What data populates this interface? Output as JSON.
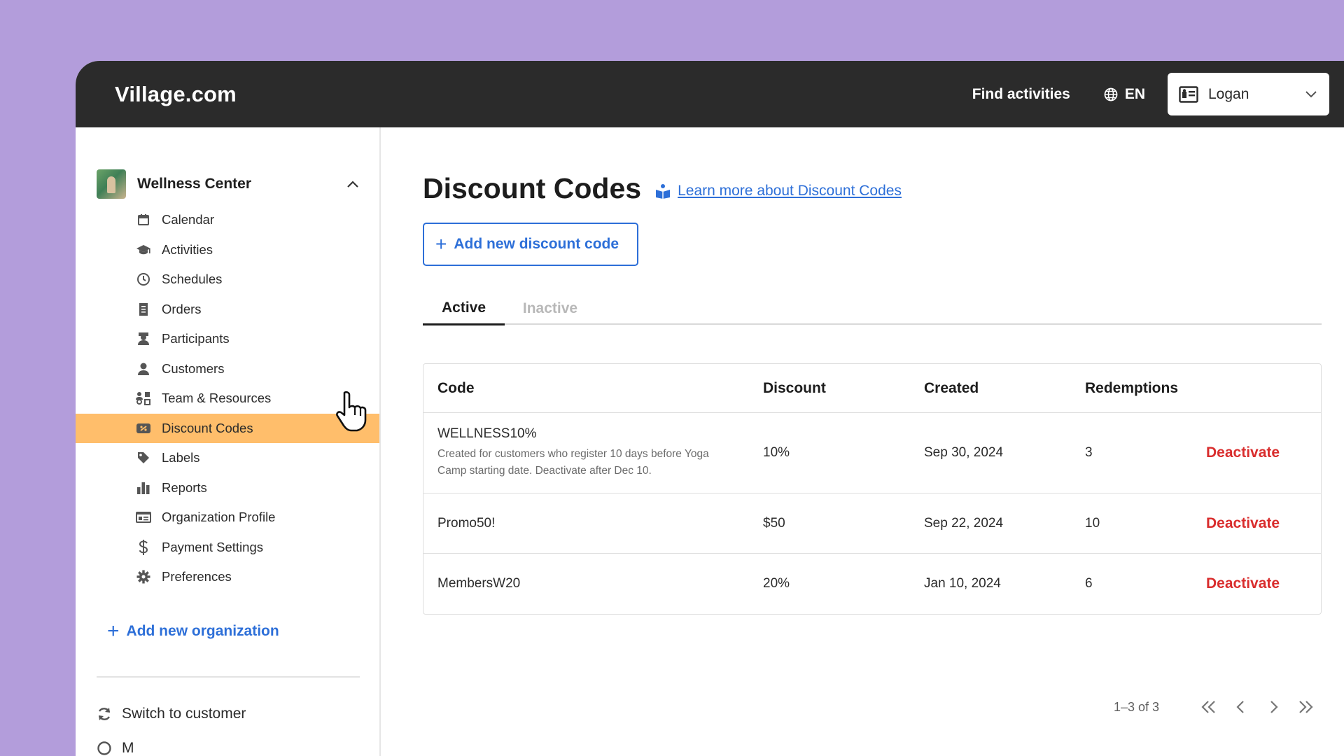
{
  "header": {
    "brand": "Village.com",
    "find_activities": "Find activities",
    "language": "EN",
    "user_name": "Logan"
  },
  "sidebar": {
    "org_name": "Wellness Center",
    "items": [
      {
        "label": "Calendar",
        "icon": "calendar-icon"
      },
      {
        "label": "Activities",
        "icon": "graduation-cap-icon"
      },
      {
        "label": "Schedules",
        "icon": "clock-icon"
      },
      {
        "label": "Orders",
        "icon": "receipt-icon"
      },
      {
        "label": "Participants",
        "icon": "participant-icon"
      },
      {
        "label": "Customers",
        "icon": "person-icon"
      },
      {
        "label": "Team & Resources",
        "icon": "team-icon"
      },
      {
        "label": "Discount Codes",
        "icon": "discount-tag-icon",
        "active": true
      },
      {
        "label": "Labels",
        "icon": "label-icon"
      },
      {
        "label": "Reports",
        "icon": "bar-chart-icon"
      },
      {
        "label": "Organization Profile",
        "icon": "id-card-icon"
      },
      {
        "label": "Payment Settings",
        "icon": "dollar-icon"
      },
      {
        "label": "Preferences",
        "icon": "gear-icon"
      }
    ],
    "add_org": "Add new organization",
    "switch_customer": "Switch to customer",
    "more_label": "M"
  },
  "main": {
    "title": "Discount Codes",
    "learn_more": "Learn more about Discount Codes",
    "add_button": "Add new discount code",
    "tabs": {
      "active": "Active",
      "inactive": "Inactive"
    },
    "table": {
      "headers": {
        "code": "Code",
        "discount": "Discount",
        "created": "Created",
        "redemptions": "Redemptions"
      },
      "rows": [
        {
          "code": "WELLNESS10%",
          "description": "Created for customers who register 10 days before Yoga Camp starting date. Deactivate after Dec 10.",
          "discount": "10%",
          "created": "Sep 30, 2024",
          "redemptions": "3",
          "action": "Deactivate"
        },
        {
          "code": "Promo50!",
          "description": "",
          "discount": "$50",
          "created": "Sep 22, 2024",
          "redemptions": "10",
          "action": "Deactivate"
        },
        {
          "code": "MembersW20",
          "description": "",
          "discount": "20%",
          "created": "Jan 10, 2024",
          "redemptions": "6",
          "action": "Deactivate"
        }
      ]
    },
    "pagination": {
      "summary": "1–3 of 3"
    }
  },
  "colors": {
    "background": "#b39ddb",
    "topbar": "#2b2b2b",
    "accent_blue": "#2d6fd8",
    "active_nav": "#ffbe6b",
    "danger": "#d92d2d"
  }
}
